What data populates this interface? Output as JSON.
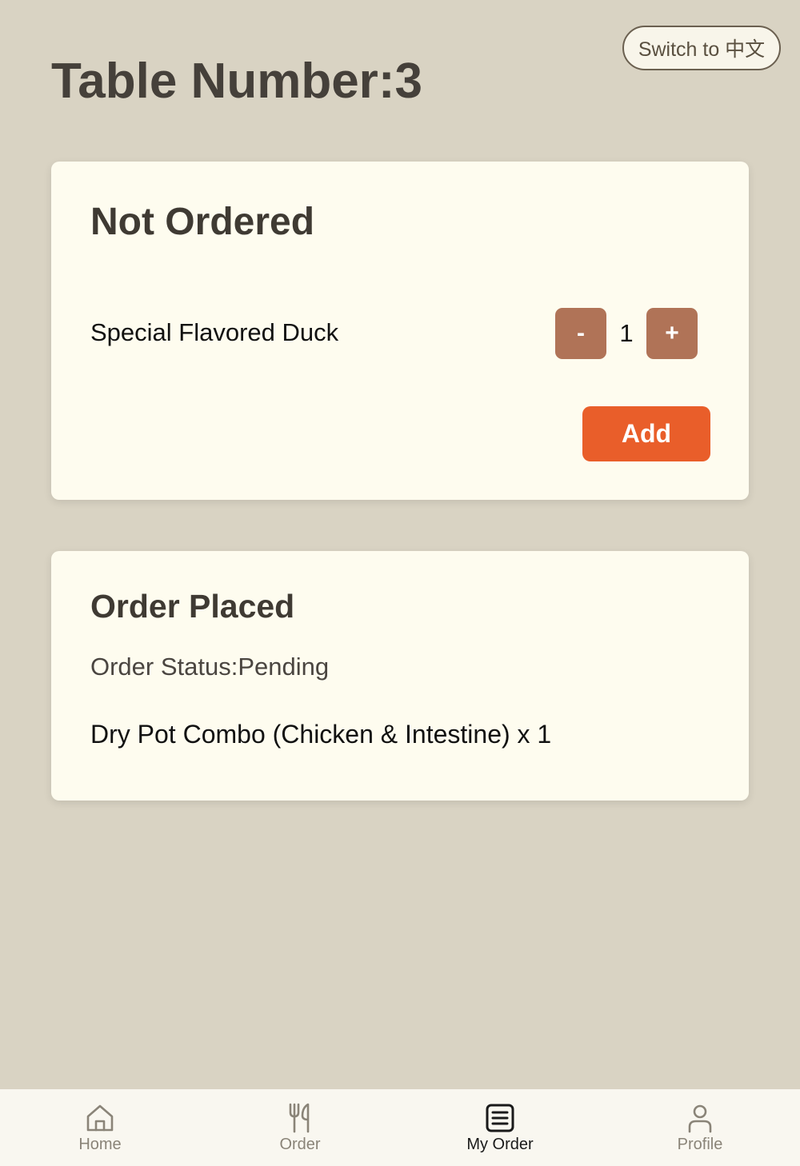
{
  "header": {
    "title": "Table Number:3",
    "language_button": "Switch to 中文"
  },
  "not_ordered": {
    "title": "Not Ordered",
    "items": [
      {
        "name": "Special Flavored Duck",
        "quantity": "1",
        "minus_label": "-",
        "plus_label": "+"
      }
    ],
    "add_button": "Add"
  },
  "order_placed": {
    "title": "Order Placed",
    "status": "Order Status:Pending",
    "items": [
      {
        "text": "Dry Pot Combo (Chicken & Intestine) x 1"
      }
    ]
  },
  "bottom_nav": {
    "active": "My Order",
    "items": [
      {
        "label": "Home",
        "icon": "home-icon"
      },
      {
        "label": "Order",
        "icon": "utensils-icon"
      },
      {
        "label": "My Order",
        "icon": "list-icon"
      },
      {
        "label": "Profile",
        "icon": "person-icon"
      }
    ]
  },
  "colors": {
    "background": "#d9d3c3",
    "card": "#fefcef",
    "accent": "#e95e2a",
    "qty_button": "#b07357",
    "nav_active": "#1a1a1a",
    "nav_inactive": "#8a8478"
  }
}
